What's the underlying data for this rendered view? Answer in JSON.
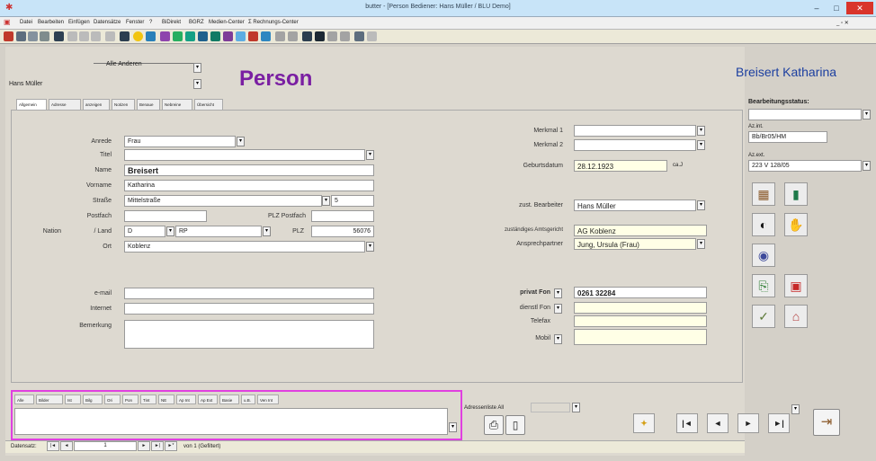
{
  "window": {
    "title": "butter - [Person   Bediener: Hans Müller / BLU Demo]",
    "minimize": "–",
    "maximize": "□",
    "close": "✕",
    "mdi_controls": "_ ▫ ✕"
  },
  "menu": [
    "Datei",
    "Bearbeiten",
    "Einfügen",
    "Datensätze",
    "Fenster",
    "?",
    "BiDirekt",
    "BGRZ",
    "Medien-Center",
    "Σ Rechnungs-Center"
  ],
  "header": {
    "user_select": "Alle Anderen",
    "user_name": "Hans Müller",
    "form_title": "Person",
    "person_name": "Breisert Katharina"
  },
  "tabs": [
    "Allgemein",
    "Adresse",
    "anzeigen",
    "Notizen",
    "Benaue",
    "Nebreine",
    "Übersicht"
  ],
  "form": {
    "anrede_label": "Anrede",
    "anrede": "Frau",
    "titel_label": "Titel",
    "titel": "",
    "name_label": "Name",
    "name": "Breisert",
    "vorname_label": "Vorname",
    "vorname": "Katharina",
    "strasse_label": "Straße",
    "strasse": "Mittelstraße",
    "hausnr": "5",
    "postfach_label": "Postfach",
    "postfach": "",
    "plz_postfach_label": "PLZ Postfach",
    "plz_postfach": "",
    "nation_label": "Nation",
    "land_label": "/ Land",
    "nation": "D",
    "land": "RP",
    "plz_label": "PLZ",
    "plz": "56076",
    "ort_label": "Ort",
    "ort": "Koblenz",
    "email_label": "e-mail",
    "email": "",
    "internet_label": "Internet",
    "internet": "",
    "bemerkung_label": "Bemerkung",
    "bemerkung": "",
    "merkmal1_label": "Merkmal 1",
    "merkmal1": "",
    "merkmal2_label": "Merkmal 2",
    "merkmal2": "",
    "geburtsdatum_label": "Geburtsdatum",
    "geburtsdatum": "28.12.1923",
    "alter_label": "ca.J",
    "bearbeiter_label": "zust. Bearbeiter",
    "bearbeiter": "Hans Müller",
    "gericht_label": "zuständiges Amtsgericht",
    "gericht": "AG Koblenz",
    "ansprech_label": "Ansprechpartner",
    "ansprech": "Jung, Ursula (Frau)",
    "privat_label": "privat Fon",
    "privat": "0261 32284",
    "dienst_label": "dienstl Fon",
    "dienst": "",
    "telefax_label": "Telefax",
    "telefax": "",
    "mobil_label": "Mobil",
    "mobil": ""
  },
  "side": {
    "status_label": "Bearbeitungsstatus:",
    "status": "",
    "azint_label": "Az.int.",
    "azint": "Bb/Br05/HM",
    "azext_label": "Az.ext.",
    "azext": "223 V 128/05"
  },
  "bottom": {
    "tabs": [
      "Alle",
      "Bilder",
      "Ist",
      "Bilg",
      "Ori",
      "Pon",
      "Tint",
      "NE",
      "Ap Int",
      "Ap Ext",
      "Basie",
      "u.B.",
      "Ven Int"
    ],
    "note": "",
    "adressliste_label": "Adressenliste All",
    "adressliste": ""
  },
  "record": {
    "label": "Datensatz:",
    "current": "1",
    "of": "von 1 (Gefiltert)",
    "nav_first": "|◄",
    "nav_prev": "◄",
    "nav_next": "►",
    "nav_last": "►|",
    "nav_new": "►*"
  },
  "nav": {
    "new": "✦",
    "first": "|◄",
    "prev": "◄",
    "next": "►",
    "last": "►|"
  },
  "colors": {
    "title": "#7a1fa2",
    "person": "#1c3fa0",
    "highlight": "#e040e0",
    "titlebar": "#c8e4f8",
    "close": "#d9342b"
  }
}
